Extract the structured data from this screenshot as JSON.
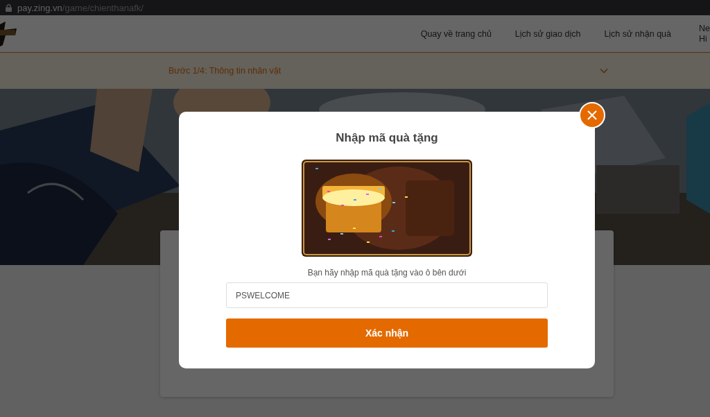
{
  "browser": {
    "url_host": "pay.zing.vn",
    "url_path": "/game/chienthanafk/"
  },
  "nav": {
    "links": [
      "Quay về trang chủ",
      "Lịch sử giao dịch",
      "Lịch sử nhận quà"
    ],
    "cut_link_lines": [
      "Ne",
      "Hi"
    ]
  },
  "step": {
    "label": "Bước 1/4: Thông tin nhân vật",
    "expanded": false
  },
  "dialog": {
    "title": "Nhập mã quà tặng",
    "prompt": "Bạn hãy nhập mã quà tặng vào ô bên dưới",
    "input": {
      "value": "PSWELCOME"
    },
    "button": "Xác nhận"
  }
}
